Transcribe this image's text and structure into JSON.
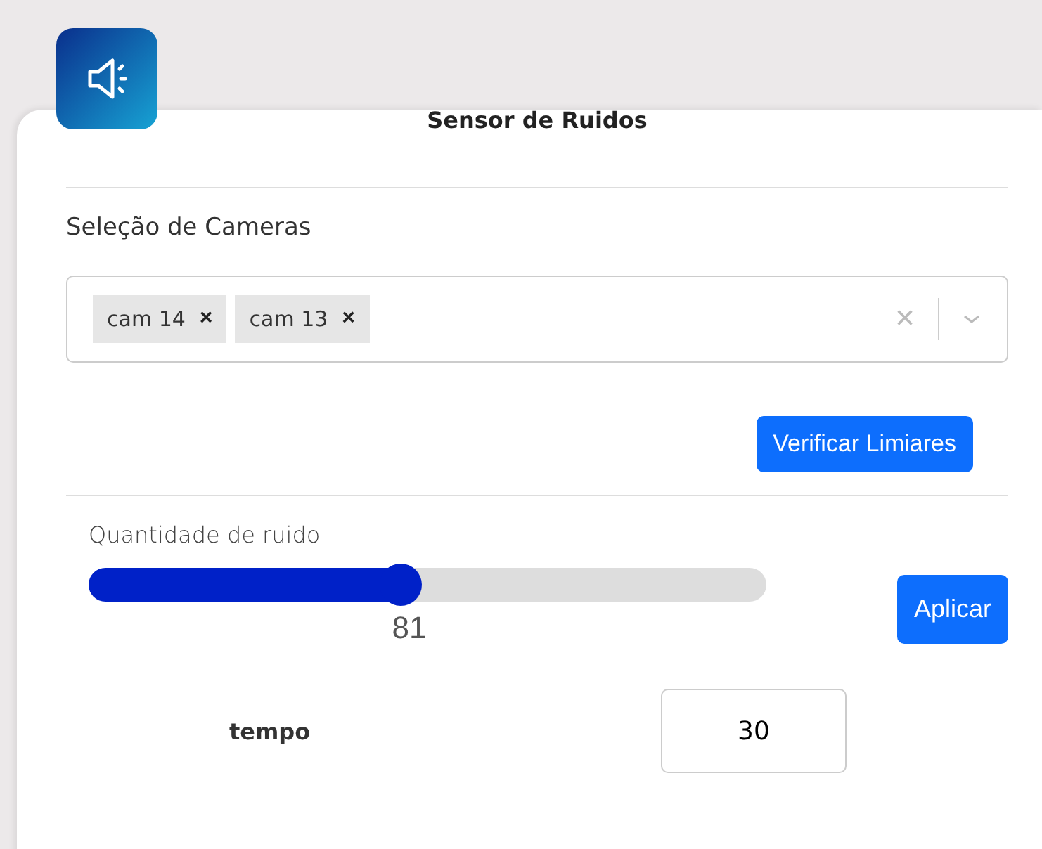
{
  "title": "Sensor de Ruidos",
  "camera_selection": {
    "label": "Seleção de Cameras",
    "selected_tags": [
      {
        "label": "cam 14",
        "remove": "×"
      },
      {
        "label": "cam 13",
        "remove": "×"
      }
    ],
    "clear": "×"
  },
  "check_button": "Verificar Limiares",
  "noise": {
    "label": "Quantidade de ruido",
    "level": 0.46,
    "reading": "81",
    "apply_button": "Aplicar"
  },
  "time": {
    "label": "tempo",
    "value": "30"
  }
}
